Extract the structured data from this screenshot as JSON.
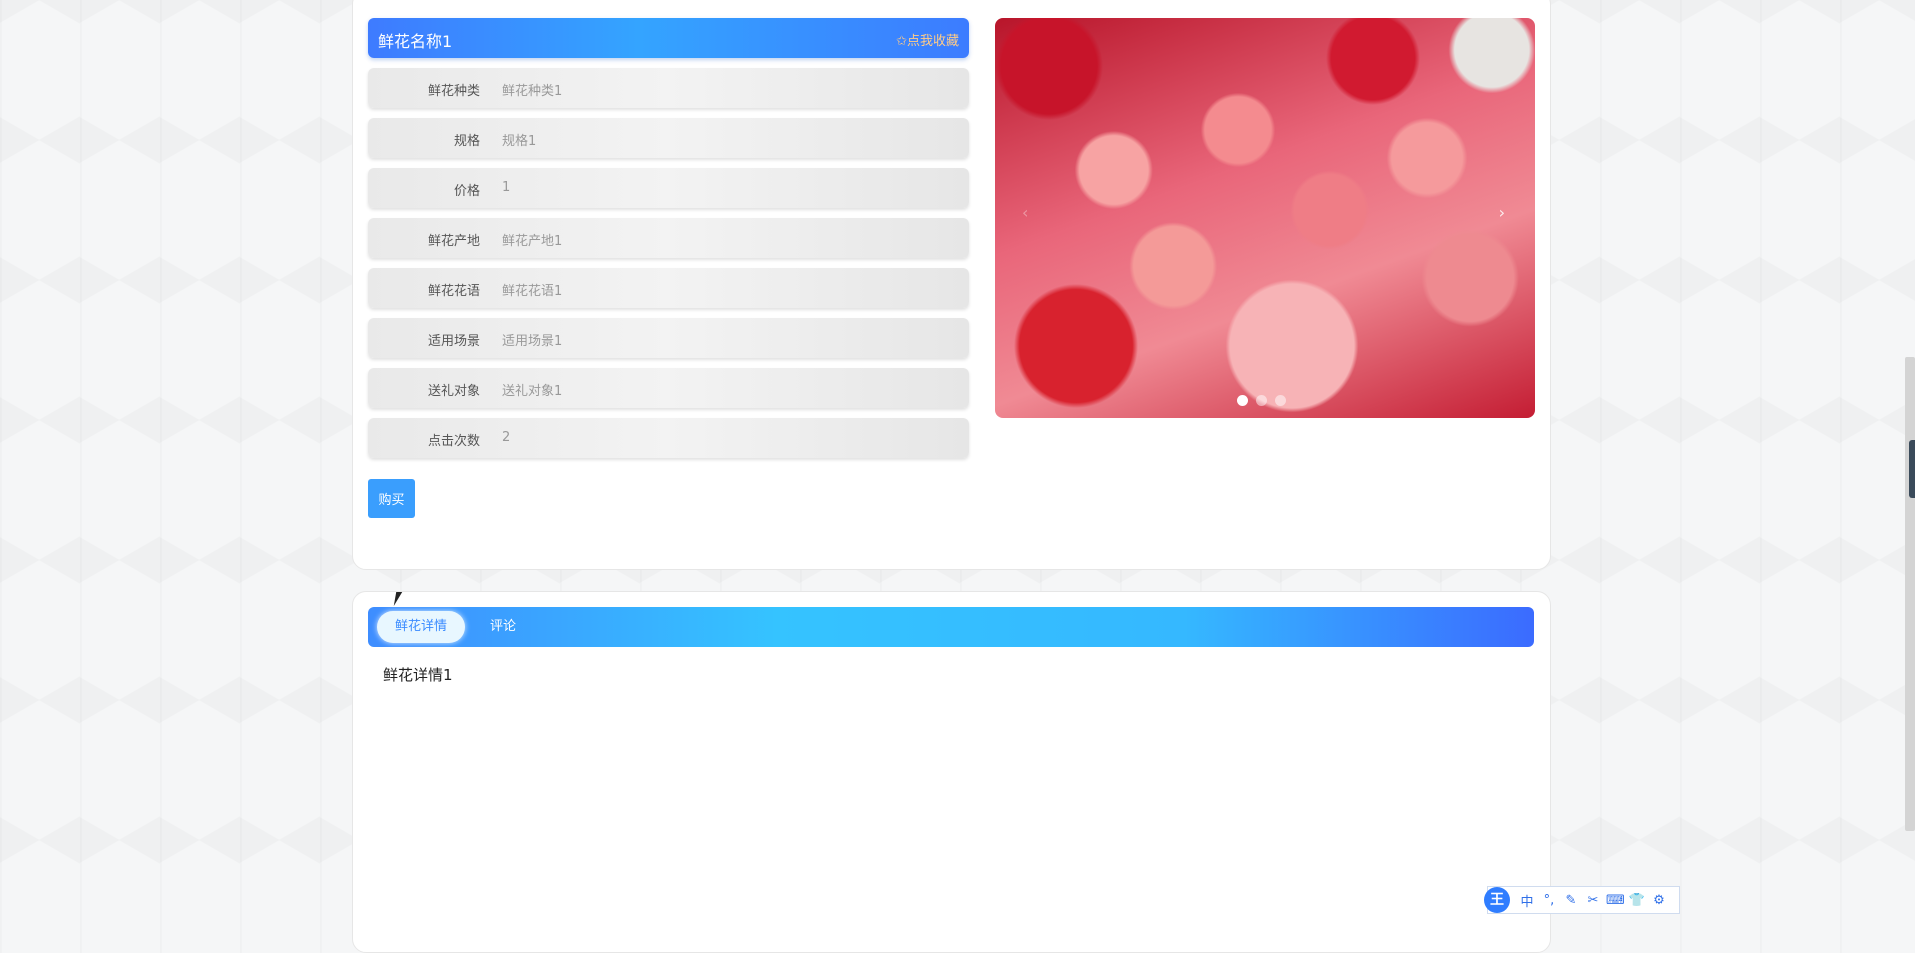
{
  "product": {
    "name": "鲜花名称1",
    "favorite_label": "✩点我收藏",
    "fields": [
      {
        "label": "鲜花种类",
        "value": "鲜花种类1"
      },
      {
        "label": "规格",
        "value": "规格1"
      },
      {
        "label": "价格",
        "value": "1"
      },
      {
        "label": "鲜花产地",
        "value": "鲜花产地1"
      },
      {
        "label": "鲜花花语",
        "value": "鲜花花语1"
      },
      {
        "label": "适用场景",
        "value": "适用场景1"
      },
      {
        "label": "送礼对象",
        "value": "送礼对象1"
      },
      {
        "label": "点击次数",
        "value": "2"
      }
    ],
    "buy_label": "购买"
  },
  "carousel": {
    "prev_icon": "‹",
    "next_icon": "›",
    "slide_count": 3,
    "active_index": 0
  },
  "tabs": [
    {
      "label": "鲜花详情",
      "active": true
    },
    {
      "label": "评论",
      "active": false
    }
  ],
  "detail": {
    "text": "鲜花详情1"
  },
  "ime_toolbar": {
    "logo": "王",
    "items": [
      "中",
      "°,",
      "✎",
      "✂",
      "⌨",
      "👕",
      "⚙"
    ]
  }
}
